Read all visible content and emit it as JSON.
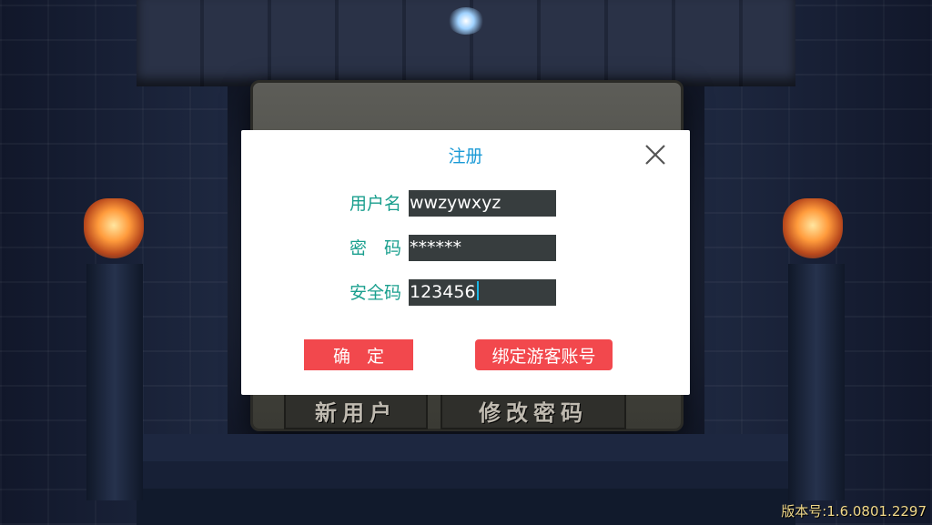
{
  "background": {
    "tablet_buttons": {
      "new_user": "新用户",
      "change_password": "修改密码"
    }
  },
  "dialog": {
    "title": "注册",
    "close_icon": "close-icon",
    "fields": {
      "username": {
        "label": "用户名",
        "value": "wwzywxyz"
      },
      "password": {
        "label": "密　码",
        "value": "******"
      },
      "security_code": {
        "label": "安全码",
        "value": "123456"
      }
    },
    "buttons": {
      "confirm": "确定",
      "bind_guest": "绑定游客账号"
    },
    "colors": {
      "title": "#1a9ad6",
      "label": "#1a9f8e",
      "button": "#f2484d",
      "input_bg": "#373d3e"
    }
  },
  "footer": {
    "version": "版本号:1.6.0801.2297"
  }
}
